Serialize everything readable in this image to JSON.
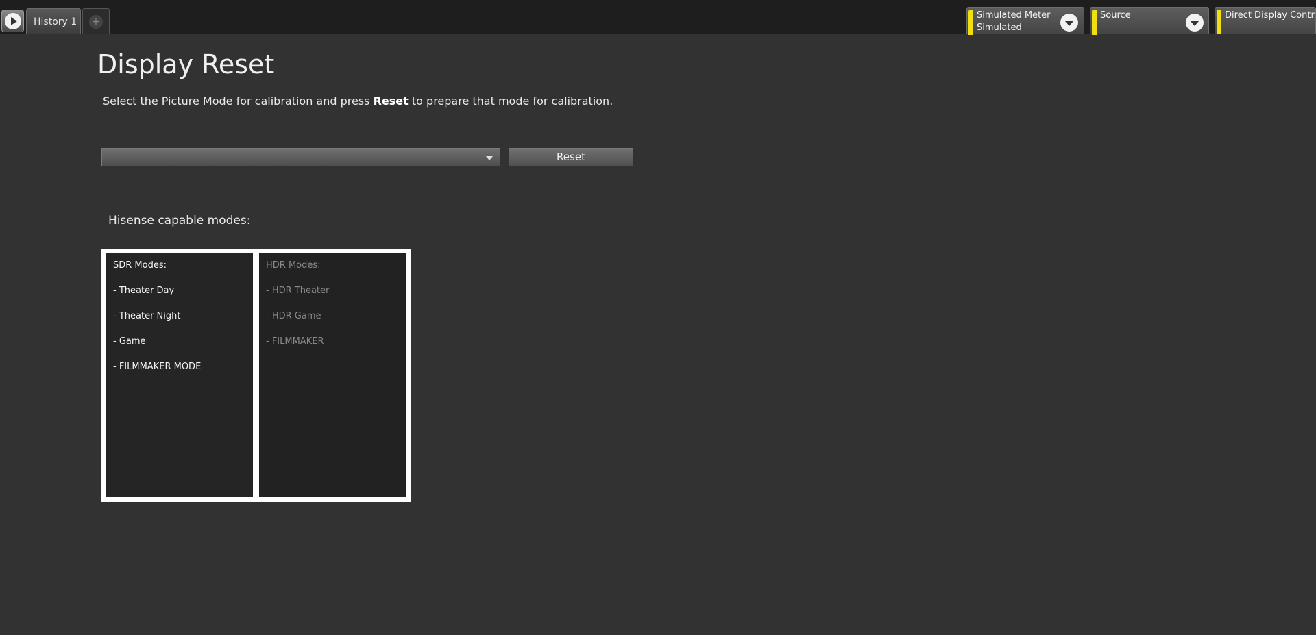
{
  "toolbar": {
    "tabs": [
      {
        "label": "History 1"
      }
    ],
    "add_tab_symbol": "+"
  },
  "panels": {
    "meter": {
      "title": "Simulated Meter",
      "value": "Simulated"
    },
    "source": {
      "title": "Source",
      "value": ""
    },
    "display": {
      "title": "Direct Display Contro"
    }
  },
  "accent_color": "#f0e012",
  "page": {
    "title": "Display Reset",
    "instruction_prefix": "Select the Picture Mode for calibration and press ",
    "instruction_bold": "Reset",
    "instruction_suffix": " to prepare that mode for calibration."
  },
  "picture_mode": {
    "selected": ""
  },
  "reset_button": {
    "label": "Reset"
  },
  "capable_modes": {
    "label": "Hisense capable modes:",
    "sdr": {
      "heading": "SDR Modes:",
      "items": [
        "- Theater Day",
        "- Theater Night",
        "- Game",
        "- FILMMAKER MODE"
      ]
    },
    "hdr": {
      "heading": "HDR Modes:",
      "items": [
        "- HDR Theater",
        "- HDR Game",
        "- FILMMAKER"
      ]
    }
  }
}
